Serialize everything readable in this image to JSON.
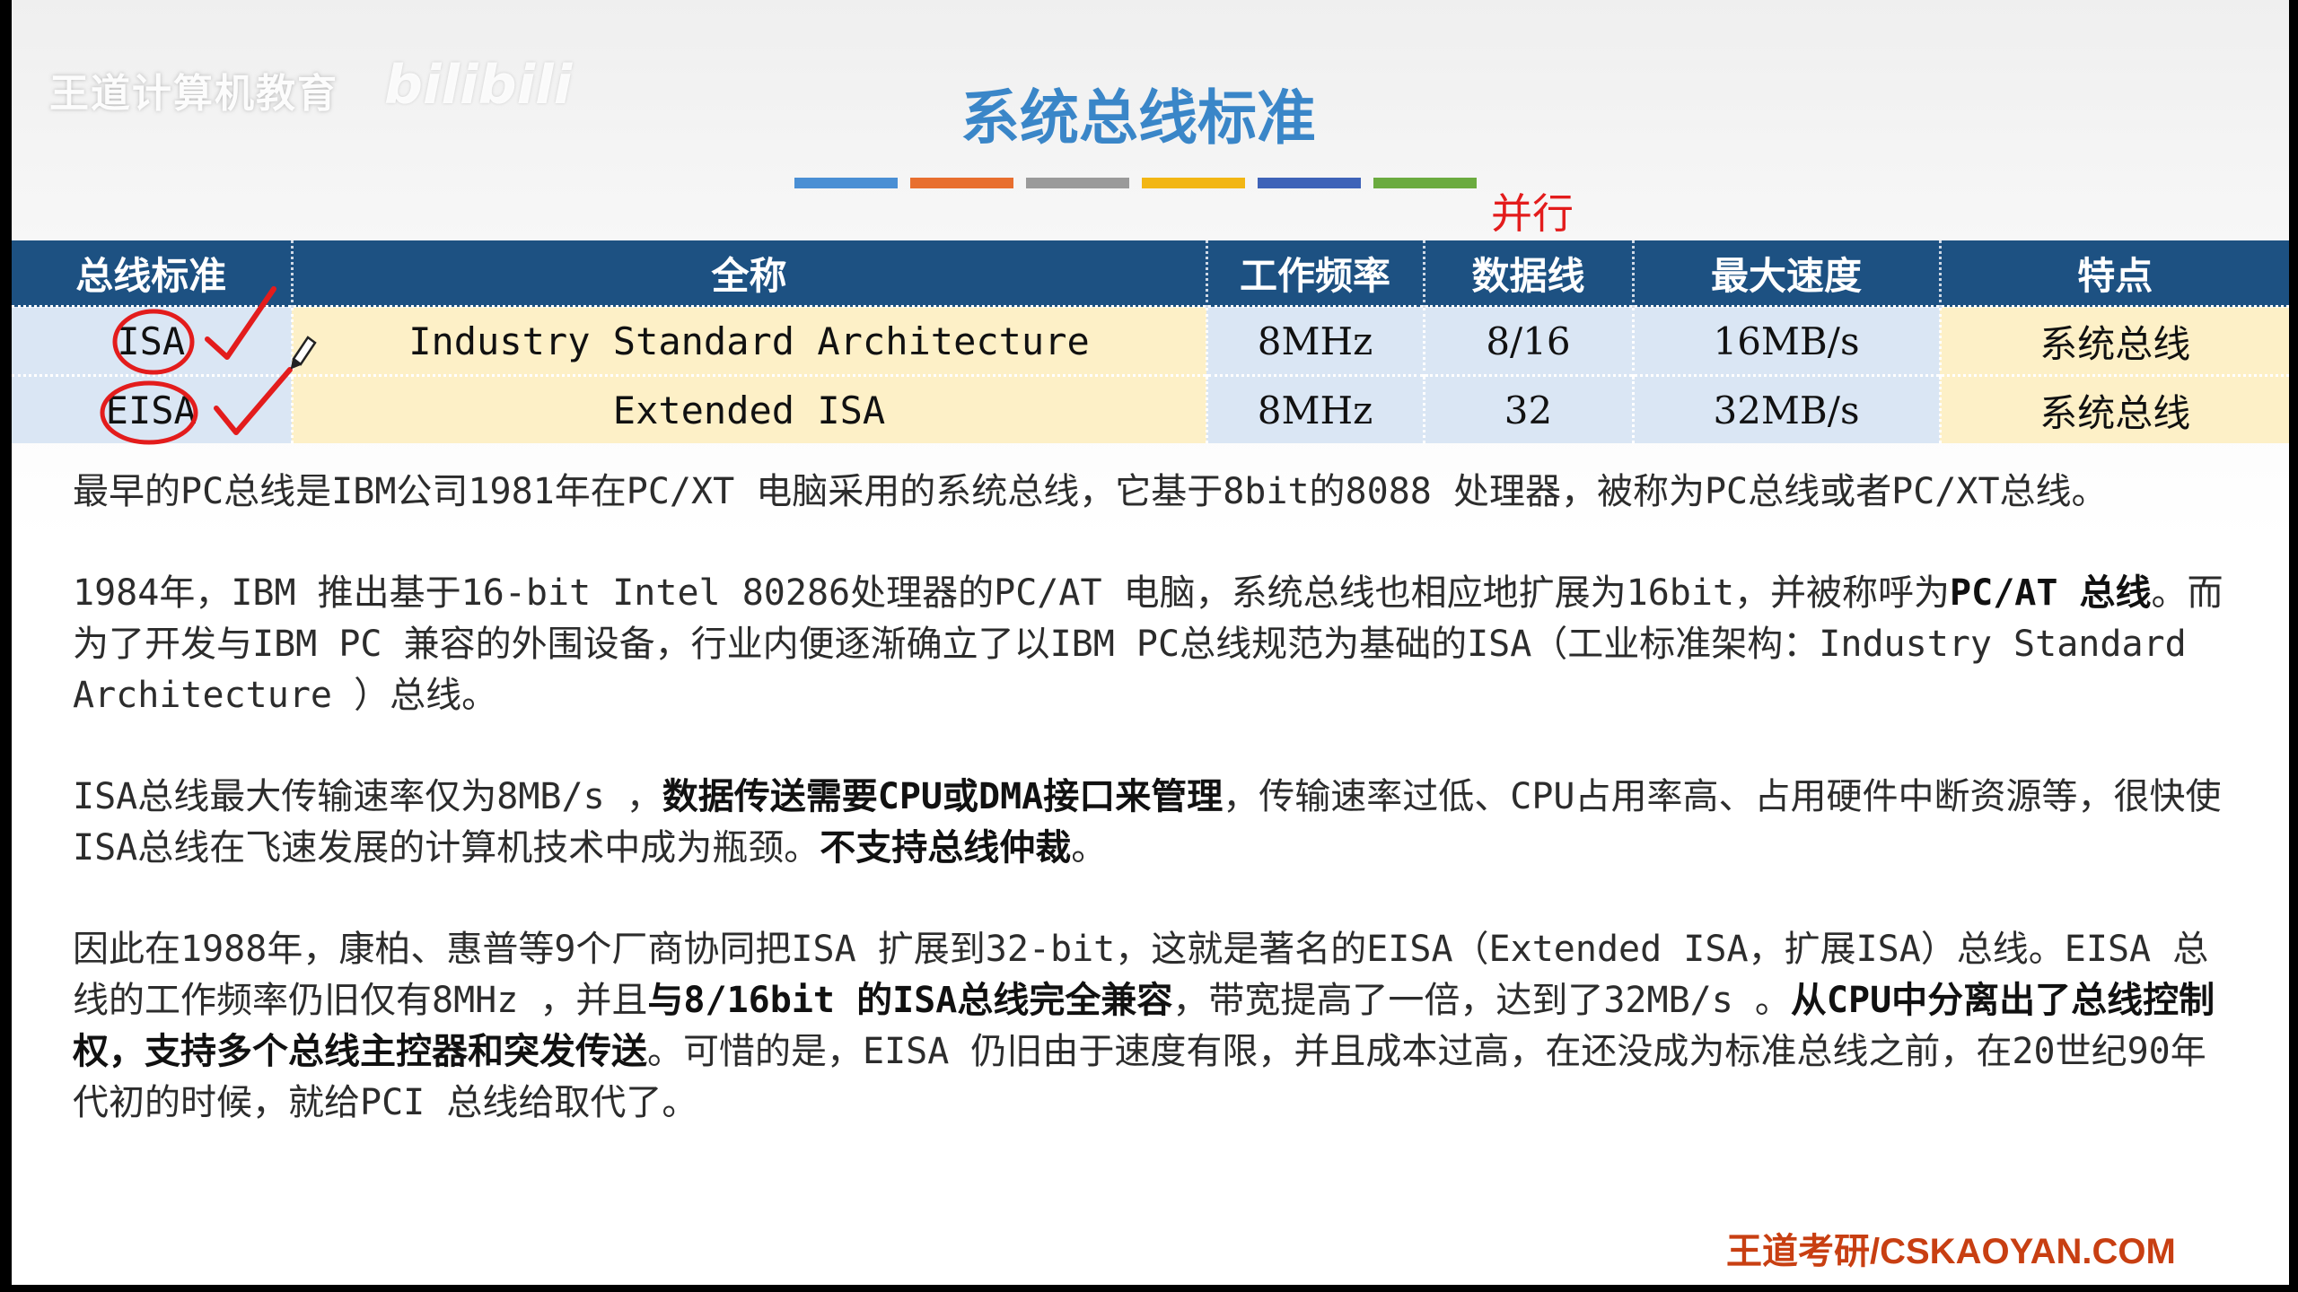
{
  "watermark": {
    "brand": "王道计算机教育",
    "logo": "bilibili"
  },
  "slide": {
    "title": "系统总线标准",
    "title_bar_colors": [
      "#4a8fd4",
      "#e86f2f",
      "#9a9a9a",
      "#f2b614",
      "#3e63b8",
      "#6bab3f"
    ],
    "handwritten_parallel": "并行"
  },
  "table": {
    "headers": {
      "standard": "总线标准",
      "full_name": "全称",
      "frequency": "工作频率",
      "data_lines": "数据线",
      "max_speed": "最大速度",
      "feature": "特点"
    },
    "rows": [
      {
        "standard": "ISA",
        "full_name": "Industry Standard Architecture",
        "frequency": "8MHz",
        "data_lines": "8/16",
        "max_speed": "16MB/s",
        "feature": "系统总线"
      },
      {
        "standard": "EISA",
        "full_name": "Extended ISA",
        "frequency": "8MHz",
        "data_lines": "32",
        "max_speed": "32MB/s",
        "feature": "系统总线"
      }
    ]
  },
  "body": {
    "p1": "最早的PC总线是IBM公司1981年在PC/XT 电脑采用的系统总线，它基于8bit的8088 处理器，被称为PC总线或者PC/XT总线。",
    "p2_a": "1984年，IBM 推出基于16-bit Intel 80286处理器的PC/AT 电脑，系统总线也相应地扩展为16bit，并被称呼为",
    "p2_b": "PC/AT 总线",
    "p2_c": "。而为了开发与IBM PC 兼容的外围设备，行业内便逐渐确立了以IBM PC总线规范为基础的ISA（工业标准架构：Industry Standard Architecture ）总线。",
    "p3_a": "ISA总线最大传输速率仅为8MB/s ，",
    "p3_b": "数据传送需要CPU或DMA接口来管理",
    "p3_c": "，传输速率过低、CPU占用率高、占用硬件中断资源等，很快使ISA总线在飞速发展的计算机技术中成为瓶颈。",
    "p3_d": "不支持总线仲裁",
    "p3_e": "。",
    "p4_a": "因此在1988年，康柏、惠普等9个厂商协同把ISA 扩展到32-bit，这就是著名的EISA（Extended ISA，扩展ISA）总线。EISA 总线的工作频率仍旧仅有8MHz ，并且",
    "p4_b": "与8/16bit 的ISA总线完全兼容",
    "p4_c": "，带宽提高了一倍，达到了32MB/s 。",
    "p4_d": "从CPU中分离出了总线控制权，支持多个总线主控器和突发传送",
    "p4_e": "。可惜的是，EISA 仍旧由于速度有限，并且成本过高，在还没成为标准总线之前，在20世纪90年代初的时候，就给PCI 总线给取代了。"
  },
  "footer": {
    "credit": "王道考研/CSKAOYAN.COM"
  },
  "annotation_icons": [
    "red-circle-icon",
    "red-checkmark-icon",
    "pencil-cursor-icon"
  ]
}
